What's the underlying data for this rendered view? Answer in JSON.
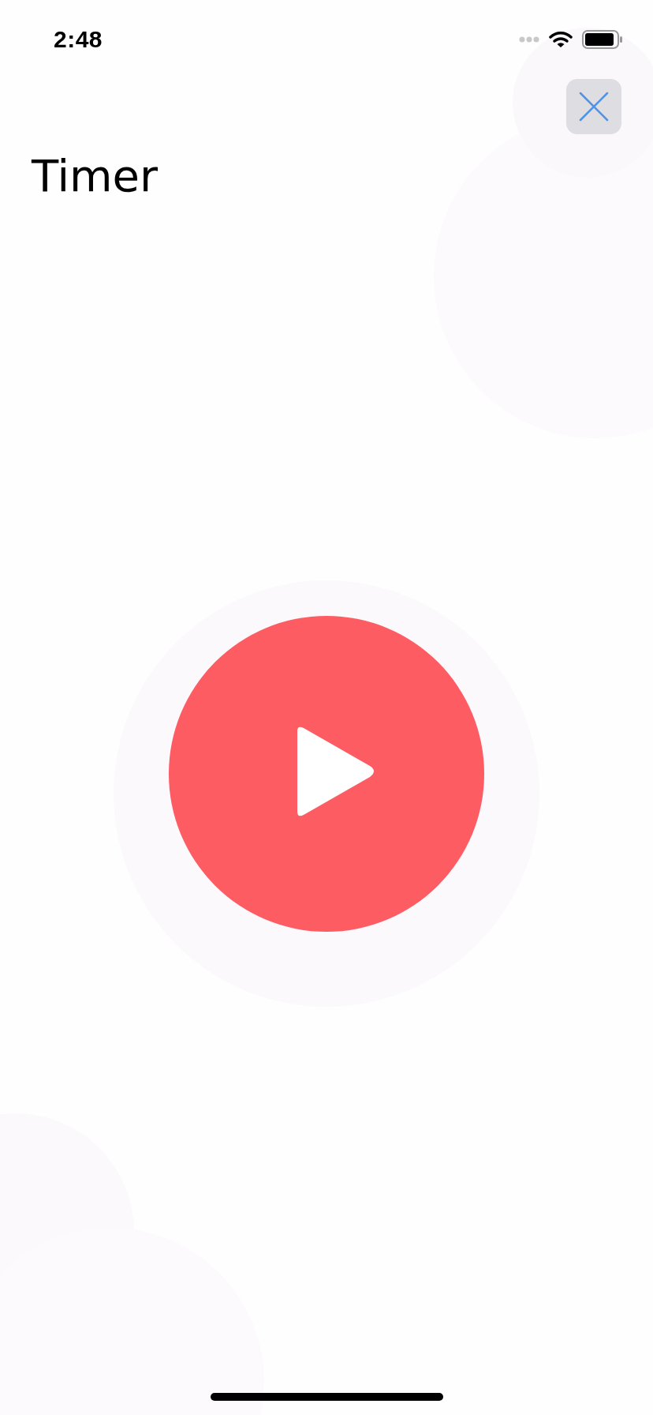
{
  "status_bar": {
    "time": "2:48"
  },
  "title": "Timer"
}
